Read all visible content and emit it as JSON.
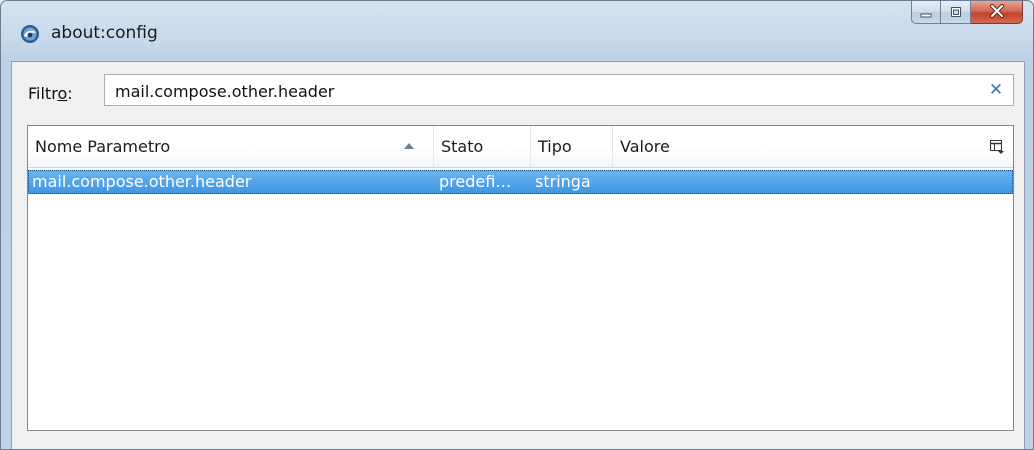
{
  "window": {
    "title": "about:config",
    "icon": "thunderbird-icon",
    "controls": [
      "minimize-icon",
      "maximize-icon",
      "close-icon"
    ]
  },
  "filter": {
    "label": "Filtro:",
    "label_accesskey": "o",
    "value": "mail.compose.other.header",
    "clear_icon": "close-icon",
    "clear_glyph": "✕"
  },
  "table": {
    "columns": [
      "Nome Parametro",
      "Stato",
      "Tipo",
      "Valore"
    ],
    "sorted_column": "Nome Parametro",
    "sort_direction": "ascending",
    "rows": [
      {
        "name": "mail.compose.other.header",
        "status": "predefi…",
        "type": "stringa",
        "value": ""
      }
    ]
  },
  "colors": {
    "selection": "#3d95e3",
    "clear_button": "#3b74b7",
    "close_button": "#c3432c"
  }
}
